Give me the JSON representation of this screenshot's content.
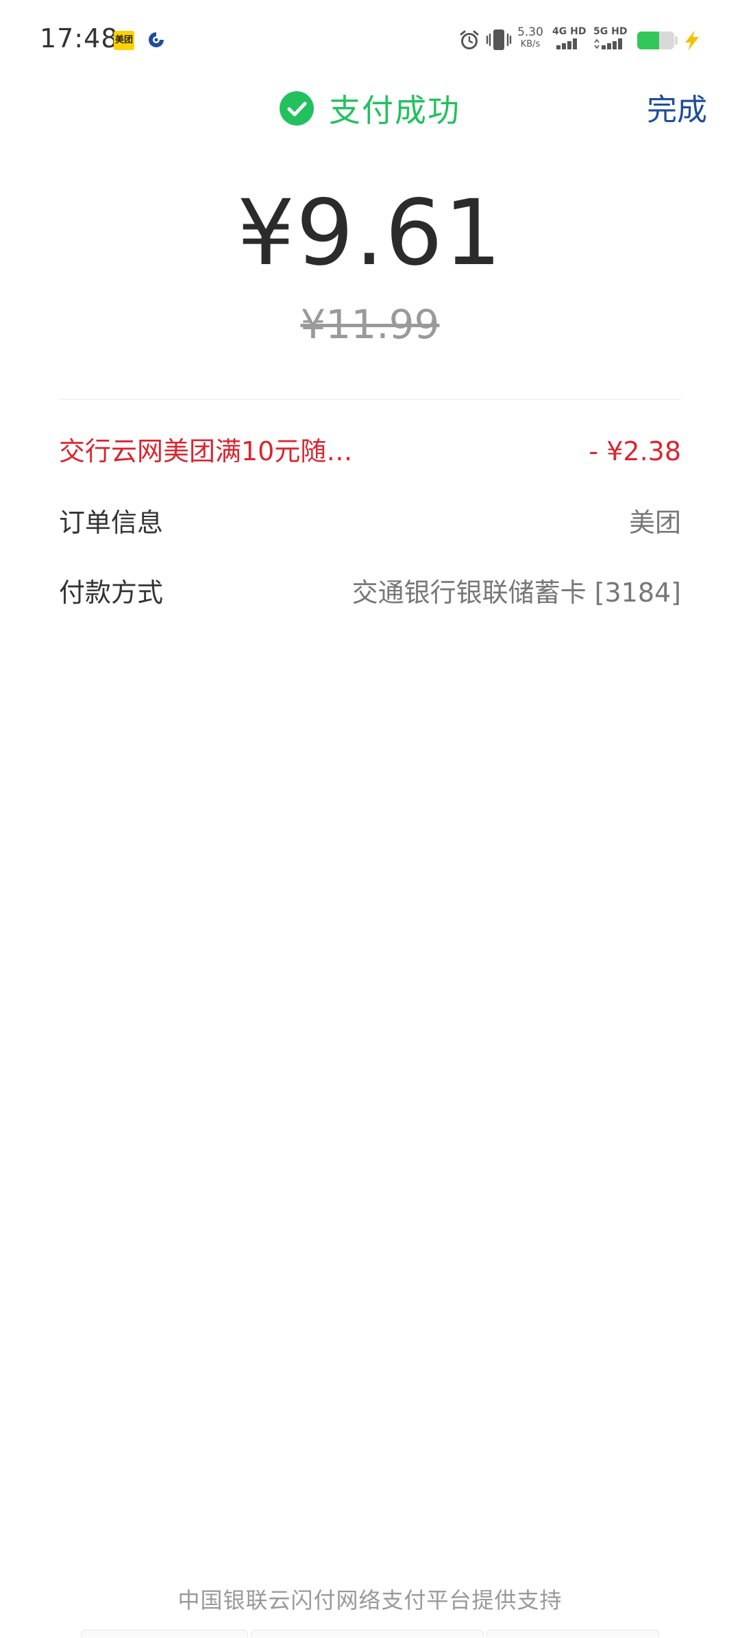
{
  "status_bar": {
    "time": "17:48",
    "app_icons": [
      {
        "name": "meituan-icon",
        "label": "美团"
      },
      {
        "name": "bank-app-icon"
      }
    ],
    "alarm_icon": "alarm-icon",
    "vibrate_icon": "vibrate-icon",
    "network_speed": {
      "value": "5.30",
      "unit": "KB/s"
    },
    "signals": [
      {
        "label": "4G HD",
        "bars": 4,
        "active": 4
      },
      {
        "label": "5G HD",
        "bars": 4,
        "active": 4
      }
    ],
    "battery_level": 0.6,
    "charging": true,
    "colors": {
      "battery": "#33c75a",
      "charge_bolt": "#F2C200"
    }
  },
  "header": {
    "status_text": "支付成功",
    "done_label": "完成",
    "colors": {
      "success": "#22C15E",
      "done": "#1E4E9C"
    }
  },
  "amount": {
    "paid": "¥9.61",
    "original": "¥11.99"
  },
  "details": {
    "discount": {
      "label": "交行云网美团满10元随…",
      "value": "- ¥2.38",
      "color": "#D9262F"
    },
    "order": {
      "label": "订单信息",
      "value": "美团"
    },
    "payment": {
      "label": "付款方式",
      "value": "交通银行银联储蓄卡 [3184]"
    }
  },
  "footer": {
    "text": "中国银联云闪付网络支付平台提供支持"
  }
}
